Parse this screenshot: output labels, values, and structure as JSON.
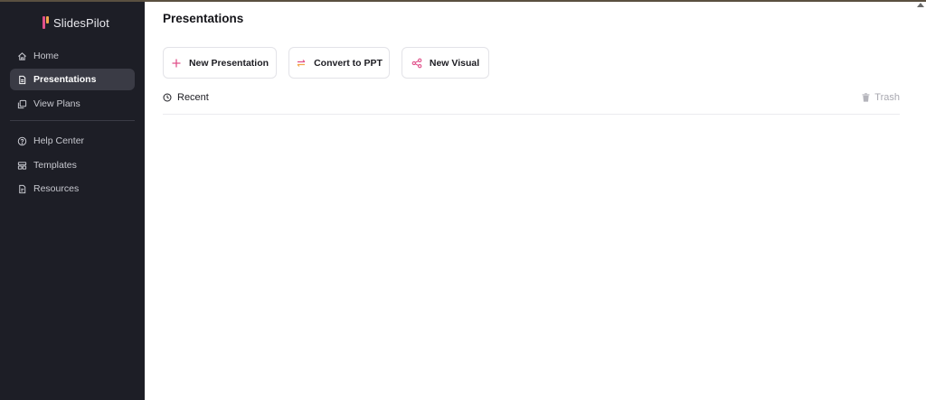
{
  "app": {
    "name": "SlidesPilot"
  },
  "sidebar": {
    "items": [
      {
        "label": "Home",
        "icon": "home-icon",
        "active": false
      },
      {
        "label": "Presentations",
        "icon": "document-icon",
        "active": true
      },
      {
        "label": "View Plans",
        "icon": "plans-icon",
        "active": false
      },
      {
        "label": "Help Center",
        "icon": "help-circle-icon",
        "active": false
      },
      {
        "label": "Templates",
        "icon": "templates-icon",
        "active": false
      },
      {
        "label": "Resources",
        "icon": "resources-icon",
        "active": false
      }
    ]
  },
  "main": {
    "title": "Presentations",
    "actions": [
      {
        "label": "New Presentation",
        "icon": "plus-icon"
      },
      {
        "label": "Convert to PPT",
        "icon": "convert-arrows-icon"
      },
      {
        "label": "New Visual",
        "icon": "share-nodes-icon"
      }
    ],
    "recent_label": "Recent",
    "trash_label": "Trash"
  },
  "colors": {
    "sidebar_bg": "#1d1e26",
    "active_item_bg": "#3a3b45",
    "accent_pink": "#e0508a",
    "accent_orange": "#f3a64a"
  }
}
